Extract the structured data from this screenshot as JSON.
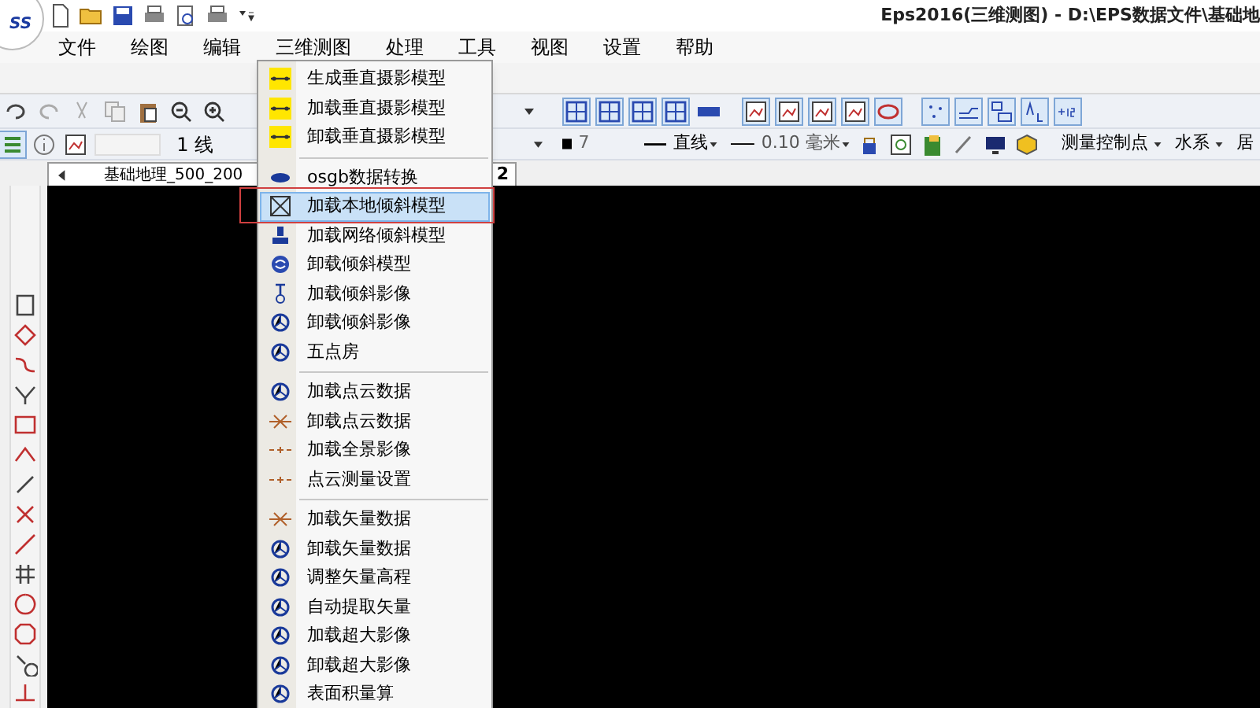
{
  "title_bar": {
    "logo_text": "SS",
    "title": "Eps2016(三维测图) - D:\\EPS数据文件\\基础地"
  },
  "menu_bar": [
    {
      "label": "文件"
    },
    {
      "label": "绘图"
    },
    {
      "label": "编辑"
    },
    {
      "label": "三维测图"
    },
    {
      "label": "处理"
    },
    {
      "label": "工具"
    },
    {
      "label": "视图"
    },
    {
      "label": "设置"
    },
    {
      "label": "帮助"
    }
  ],
  "line_toolbar": {
    "value": "1 线"
  },
  "style_toolbar": {
    "color_index": "7",
    "line_type": "直线",
    "line_width": "0.10 毫米",
    "dropdowns": [
      "测量控制点",
      "水系",
      "居"
    ]
  },
  "document_tab": {
    "label": "基础地理_500_200",
    "label_tail": "2"
  },
  "dropdown_menu": {
    "items": [
      {
        "kind": "strip",
        "label": "生成垂直摄影模型",
        "selected": false
      },
      {
        "kind": "strip",
        "label": "加载垂直摄影模型",
        "selected": false
      },
      {
        "kind": "strip",
        "label": "卸载垂直摄影模型",
        "selected": false
      },
      {
        "kind": "separator"
      },
      {
        "kind": "capsule",
        "label": "osgb数据转换",
        "selected": false
      },
      {
        "kind": "frame",
        "label": "加载本地倾斜模型",
        "selected": true
      },
      {
        "kind": "pin",
        "label": "加载网络倾斜模型",
        "selected": false
      },
      {
        "kind": "swirl",
        "label": "卸载倾斜模型",
        "selected": false
      },
      {
        "kind": "plumb",
        "label": "加载倾斜影像",
        "selected": false
      },
      {
        "kind": "ring",
        "label": "卸载倾斜影像",
        "selected": false
      },
      {
        "kind": "ring",
        "label": "五点房",
        "selected": false
      },
      {
        "kind": "separator"
      },
      {
        "kind": "ring",
        "label": "加载点云数据",
        "selected": false
      },
      {
        "kind": "cross",
        "label": "卸载点云数据",
        "selected": false
      },
      {
        "kind": "dots",
        "label": "加载全景影像",
        "selected": false
      },
      {
        "kind": "dots",
        "label": "点云测量设置",
        "selected": false
      },
      {
        "kind": "separator"
      },
      {
        "kind": "cross",
        "label": "加载矢量数据",
        "selected": false
      },
      {
        "kind": "ring",
        "label": "卸载矢量数据",
        "selected": false
      },
      {
        "kind": "ring",
        "label": "调整矢量高程",
        "selected": false
      },
      {
        "kind": "ring",
        "label": "自动提取矢量",
        "selected": false
      },
      {
        "kind": "ring",
        "label": "加载超大影像",
        "selected": false
      },
      {
        "kind": "ring",
        "label": "卸载超大影像",
        "selected": false
      },
      {
        "kind": "ring",
        "label": "表面积量算",
        "selected": false
      }
    ]
  }
}
